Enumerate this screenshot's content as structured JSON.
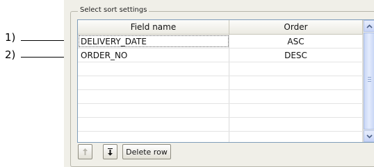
{
  "annotations": [
    {
      "label": "1)"
    },
    {
      "label": "2)"
    }
  ],
  "group": {
    "title": "Select sort settings"
  },
  "table": {
    "columns": [
      "Field name",
      "Order"
    ],
    "rows": [
      {
        "field": "DELIVERY_DATE",
        "order": "ASC"
      },
      {
        "field": "ORDER_NO",
        "order": "DESC"
      },
      {
        "field": "",
        "order": ""
      },
      {
        "field": "",
        "order": ""
      },
      {
        "field": "",
        "order": ""
      },
      {
        "field": "",
        "order": ""
      },
      {
        "field": "",
        "order": ""
      },
      {
        "field": "",
        "order": ""
      }
    ]
  },
  "buttons": {
    "move_up_icon": "arrow-up-icon",
    "move_down_icon": "arrow-down-icon",
    "delete_row": "Delete row"
  },
  "colors": {
    "grid_border": "#7f9db9",
    "panel_bg": "#f0efe8"
  }
}
